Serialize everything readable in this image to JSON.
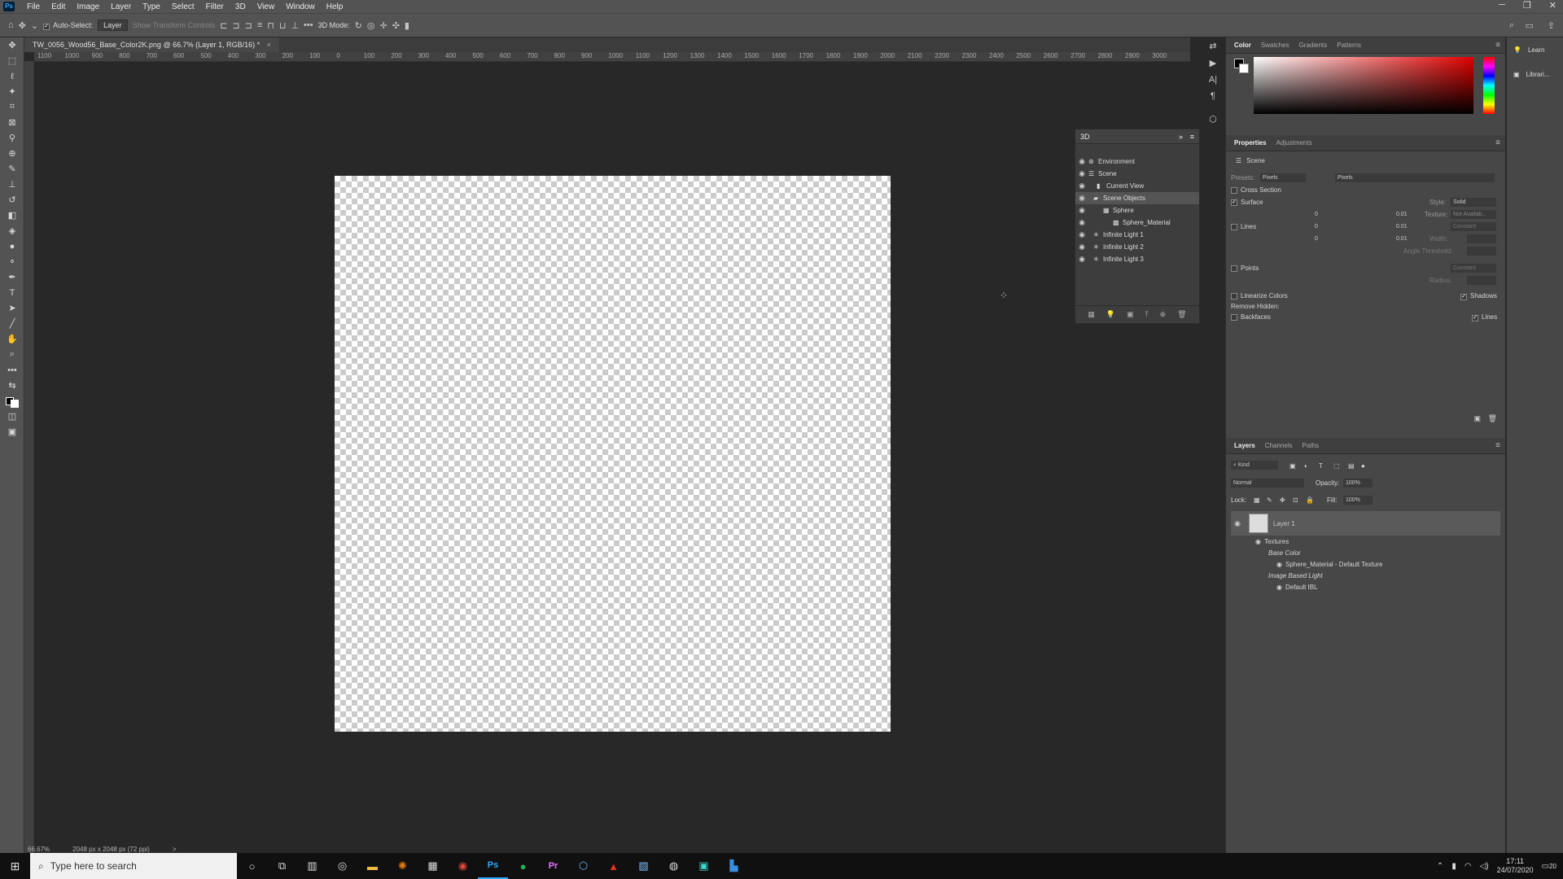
{
  "menu": {
    "items": [
      "File",
      "Edit",
      "Image",
      "Layer",
      "Type",
      "Select",
      "Filter",
      "3D",
      "View",
      "Window",
      "Help"
    ]
  },
  "options": {
    "auto_select_label": "Auto-Select:",
    "target_value": "Layer",
    "transform_label": "Show Transform Controls",
    "mode_label": "3D Mode:"
  },
  "doc": {
    "tab_title": "TW_0056_Wood56_Base_Color2K.png @ 66.7% (Layer 1, RGB/16) *",
    "close_glyph": "×"
  },
  "ruler": {
    "h_ticks": [
      "1100",
      "1000",
      "900",
      "800",
      "700",
      "600",
      "500",
      "400",
      "300",
      "200",
      "100",
      "0",
      "100",
      "200",
      "300",
      "400",
      "500",
      "600",
      "700",
      "800",
      "900",
      "1000",
      "1100",
      "1200",
      "1300",
      "1400",
      "1500",
      "1600",
      "1700",
      "1800",
      "1900",
      "2000",
      "2100",
      "2200",
      "2300",
      "2400",
      "2500",
      "2600",
      "2700",
      "2800",
      "2900",
      "3000"
    ]
  },
  "status": {
    "zoom": "66.67%",
    "size": "2048 px x 2048 px (72 ppi)",
    "arrow": ">"
  },
  "panel3d": {
    "title": "3D",
    "rows": [
      {
        "label": "Environment"
      },
      {
        "label": "Scene"
      },
      {
        "label": "Current View"
      },
      {
        "label": "Scene Objects"
      },
      {
        "label": "Sphere"
      },
      {
        "label": "Sphere_Material"
      },
      {
        "label": "Infinite Light 1"
      },
      {
        "label": "Infinite Light 2"
      },
      {
        "label": "Infinite Light 3"
      }
    ]
  },
  "color_panel": {
    "tabs": [
      "Color",
      "Swatches",
      "Gradients",
      "Patterns"
    ]
  },
  "properties": {
    "tabs": [
      "Properties",
      "Adjustments"
    ],
    "scene_label": "Scene",
    "presets_label": "Presets:",
    "preset_value": "Pixels",
    "preset_value2": "Pixels",
    "cross_section": "Cross Section",
    "surface": "Surface",
    "style_label": "Style:",
    "style_value": "Solid",
    "texture_label": "Texture:",
    "texture_value": "Not Availab...",
    "lines": "Lines",
    "lines_style": "Constant",
    "width_label": "Width:",
    "angle_label": "Angle Threshold:",
    "points": "Points",
    "points_style": "Constant",
    "radius_label": "Radius:",
    "linearize": "Linearize Colors",
    "shadows": "Shadows",
    "remove_hidden": "Remove Hidden:",
    "backfaces": "Backfaces",
    "lines2": "Lines",
    "v0": "0",
    "v001": "0.01"
  },
  "layers": {
    "tabs": [
      "Layers",
      "Channels",
      "Paths"
    ],
    "kind": "Kind",
    "blend": "Normal",
    "opacity_label": "Opacity:",
    "opacity": "100%",
    "lock_label": "Lock:",
    "fill_label": "Fill:",
    "fill": "100%",
    "layer_name": "Layer 1",
    "textures": "Textures",
    "base_color": "Base Color",
    "sphere_tex": "Sphere_Material - Default Texture",
    "ibl": "Image Based Light",
    "default_ibl": "Default IBL"
  },
  "learn": {
    "learn": "Learn",
    "libraries": "Librari..."
  },
  "taskbar": {
    "search_placeholder": "Type here to search",
    "time": "17:11",
    "date": "24/07/2020",
    "notif": "20"
  }
}
